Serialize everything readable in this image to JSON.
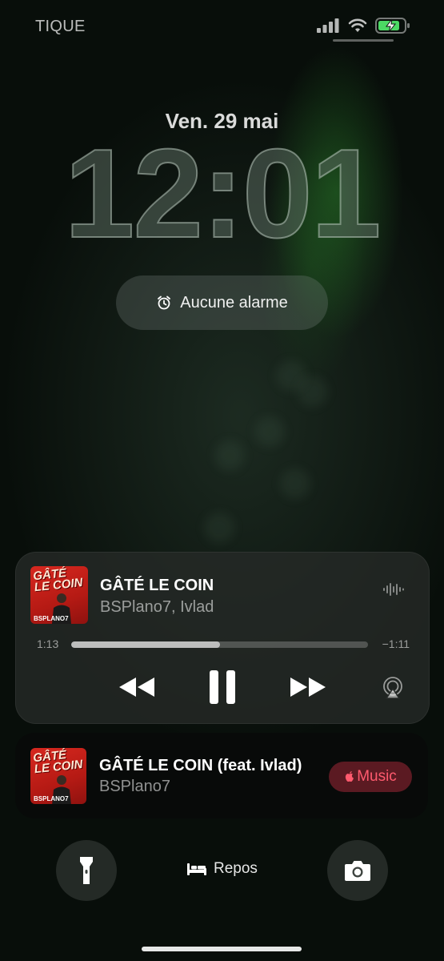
{
  "status_bar": {
    "carrier": "TIQUE",
    "icons": [
      "signal-icon",
      "wifi-icon",
      "battery-charging-icon"
    ]
  },
  "lock": {
    "date": "Ven. 29 mai",
    "time": "12:01"
  },
  "alarm": {
    "icon": "alarm-clock-icon",
    "label": "Aucune alarme"
  },
  "now_playing": {
    "cover_title": "GÂTÉ LE COIN",
    "cover_artist": "BSPLANO7",
    "title": "GÂTÉ LE COIN",
    "artist": "BSPlano7, Ivlad",
    "elapsed": "1:13",
    "remaining": "−1:11",
    "progress": 0.5,
    "controls": [
      "rewind-icon",
      "pause-icon",
      "fast-forward-icon",
      "airplay-icon"
    ]
  },
  "suggestion": {
    "cover_title": "GÂTÉ LE COIN",
    "cover_artist": "BSPLANO7",
    "title": "GÂTÉ LE COIN (feat. Ivlad)",
    "artist": "BSPlano7",
    "app_label": "Music",
    "app_color": "#ff5a6e"
  },
  "bottom": {
    "left_icon": "flashlight-icon",
    "focus_icon": "bed-icon",
    "focus_label": "Repos",
    "right_icon": "camera-icon"
  },
  "colors": {
    "accent_green": "#2a7a2a",
    "music_red": "#ff5a6e",
    "battery_green": "#4cd964"
  }
}
